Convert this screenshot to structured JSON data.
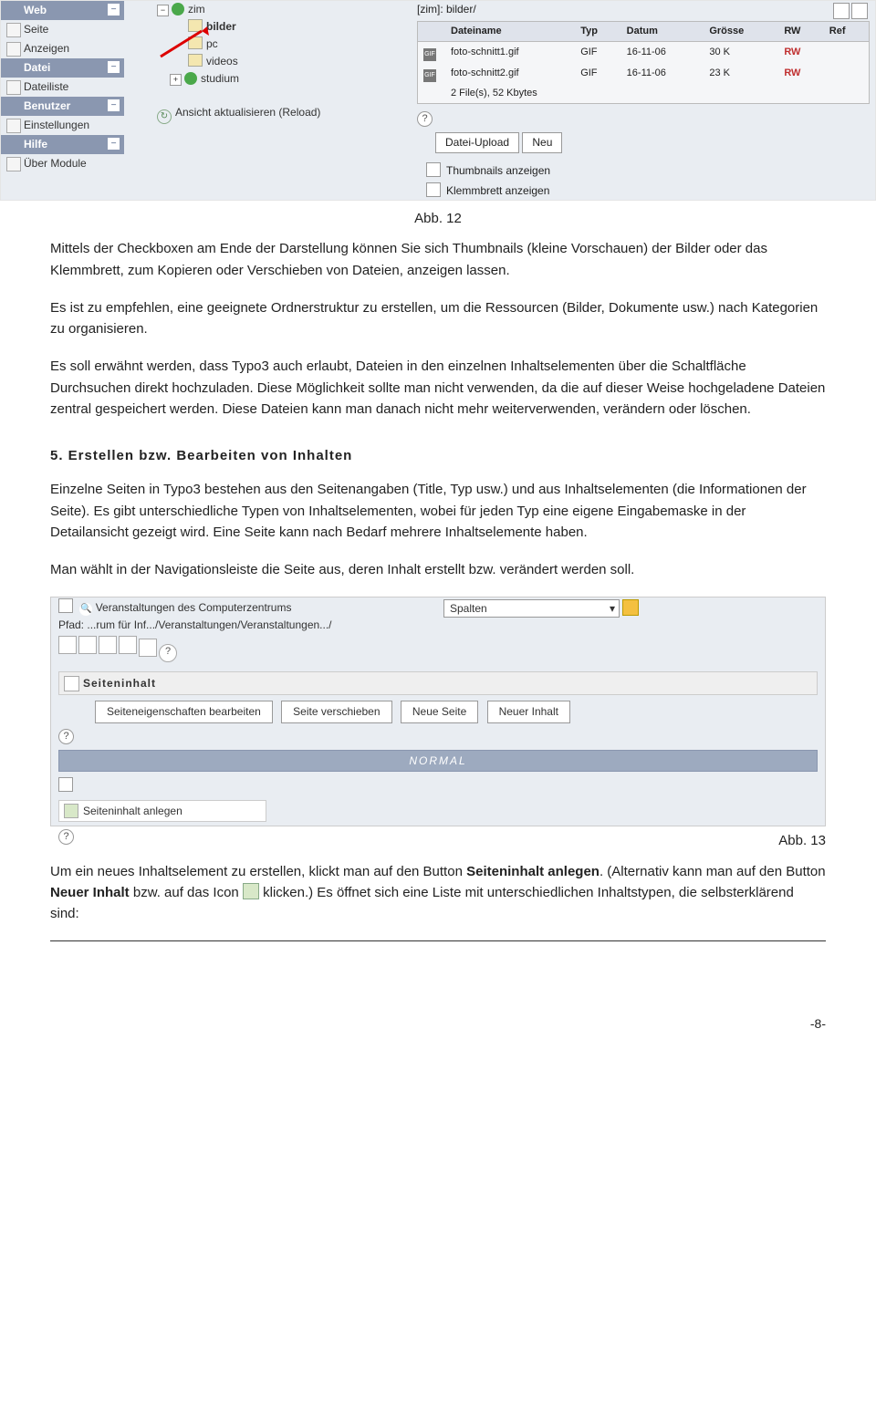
{
  "fig12": {
    "caption": "Abb. 12",
    "sidebar": {
      "groups": [
        {
          "label": "Web",
          "items": [
            "Seite",
            "Anzeigen"
          ]
        },
        {
          "label": "Datei",
          "items": [
            "Dateiliste"
          ]
        },
        {
          "label": "Benutzer",
          "items": [
            "Einstellungen"
          ]
        },
        {
          "label": "Hilfe",
          "items": [
            "Über Module"
          ]
        }
      ]
    },
    "tree": {
      "root": "zim",
      "nodes": [
        "bilder",
        "pc",
        "videos",
        "studium"
      ],
      "reload": "Ansicht aktualisieren (Reload)"
    },
    "files": {
      "path": "[zim]: bilder/",
      "cols": [
        "Dateiname",
        "Typ",
        "Datum",
        "Grösse",
        "RW",
        "Ref"
      ],
      "rows": [
        {
          "name": "foto-schnitt1.gif",
          "typ": "GIF",
          "datum": "16-11-06",
          "gr": "30 K",
          "rw": "RW"
        },
        {
          "name": "foto-schnitt2.gif",
          "typ": "GIF",
          "datum": "16-11-06",
          "gr": "23 K",
          "rw": "RW"
        }
      ],
      "summary": "2 File(s), 52 Kbytes",
      "upload": "Datei-Upload",
      "neu": "Neu",
      "thumbs": "Thumbnails anzeigen",
      "clip": "Klemmbrett anzeigen"
    }
  },
  "body": {
    "p1": "Mittels der Checkboxen am Ende der Darstellung können Sie sich Thumbnails (kleine Vorschauen) der Bilder oder das Klemmbrett, zum Kopieren oder Verschieben von Dateien, anzeigen lassen.",
    "p2": "Es ist zu empfehlen, eine geeignete Ordnerstruktur zu erstellen, um die Ressourcen (Bilder, Dokumente usw.) nach Kategorien zu organisieren.",
    "p3": "Es soll erwähnt werden, dass Typo3 auch erlaubt, Dateien in den einzelnen Inhaltselementen über die Schaltfläche Durchsuchen direkt hochzuladen. Diese Möglichkeit sollte man nicht verwenden, da die auf dieser Weise hochgeladene Dateien zentral gespeichert werden. Diese Dateien kann man danach nicht mehr weiterverwenden, verändern oder löschen.",
    "h2": "5. Erstellen bzw. Bearbeiten von Inhalten",
    "p4": "Einzelne Seiten in Typo3 bestehen aus den Seitenangaben (Title, Typ usw.) und aus Inhaltselementen (die Informationen der Seite). Es gibt unterschiedliche Typen von Inhaltselementen, wobei für jeden Typ eine eigene Eingabemaske in der Detailansicht gezeigt wird. Eine Seite kann nach Bedarf mehrere Inhaltselemente haben.",
    "p5": "Man wählt in der Navigationsleiste die Seite aus, deren Inhalt erstellt bzw. verändert werden soll."
  },
  "fig13": {
    "title": "Veranstaltungen des Computerzentrums",
    "path": "Pfad: ...rum für Inf.../Veranstaltungen/Veranstaltungen.../",
    "select": "Spalten",
    "panel": "Seiteninhalt",
    "btns": [
      "Seiteneigenschaften bearbeiten",
      "Seite verschieben",
      "Neue Seite",
      "Neuer Inhalt"
    ],
    "normal": "NORMAL",
    "anlegen": "Seiteninhalt anlegen",
    "caption": "Abb. 13"
  },
  "tail": {
    "t1": "Um ein neues Inhaltselement zu erstellen, klickt man auf den Button ",
    "b1": "Seiteninhalt anlegen",
    "t2": ". (Alternativ kann man auf den Button ",
    "b2": "Neuer Inhalt",
    "t3": " bzw. auf das Icon ",
    "t4": " klicken.) Es öffnet sich eine Liste mit unterschiedlichen Inhaltstypen, die selbsterklärend sind:",
    "page": "-8-"
  }
}
